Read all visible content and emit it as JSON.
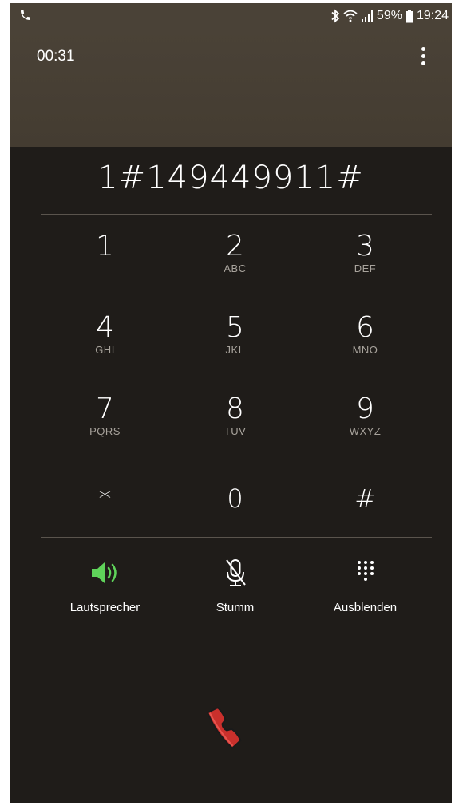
{
  "status_bar": {
    "battery": "59%",
    "time": "19:24",
    "icons": [
      "phone-call-icon",
      "bluetooth-icon",
      "wifi-icon",
      "signal-icon",
      "battery-icon"
    ]
  },
  "call": {
    "timer": "00:31",
    "dialed_number": "1#149449911#"
  },
  "keypad": [
    {
      "digit": "1",
      "letters": ""
    },
    {
      "digit": "2",
      "letters": "ABC"
    },
    {
      "digit": "3",
      "letters": "DEF"
    },
    {
      "digit": "4",
      "letters": "GHI"
    },
    {
      "digit": "5",
      "letters": "JKL"
    },
    {
      "digit": "6",
      "letters": "MNO"
    },
    {
      "digit": "7",
      "letters": "PQRS"
    },
    {
      "digit": "8",
      "letters": "TUV"
    },
    {
      "digit": "9",
      "letters": "WXYZ"
    },
    {
      "digit": "*",
      "letters": ""
    },
    {
      "digit": "0",
      "letters": ""
    },
    {
      "digit": "#",
      "letters": ""
    }
  ],
  "actions": {
    "speaker_label": "Lautsprecher",
    "mute_label": "Stumm",
    "hide_label": "Ausblenden"
  },
  "colors": {
    "header": "#4a4237",
    "background": "#1f1c19",
    "speaker_active": "#5fd35a",
    "end_call": "#c9302c"
  }
}
